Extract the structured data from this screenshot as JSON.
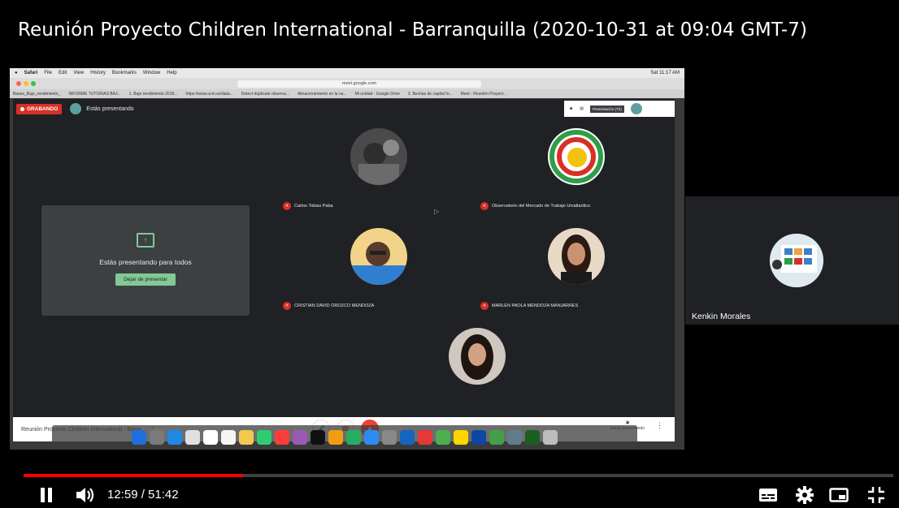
{
  "video": {
    "title": "Reunión Proyecto Children International - Barranquilla (2020-10-31 at 09:04 GMT-7)"
  },
  "mac": {
    "menubar": [
      "Safari",
      "File",
      "Edit",
      "View",
      "History",
      "Bookmarks",
      "Window",
      "Help"
    ],
    "clock": "Sat 11:17 AM",
    "url": "meet.google.com",
    "bookmarks": [
      "Bases_Bajo_rendimiento_",
      "INFORME TUTORIAS BAJ...",
      "1. Bajo rendimiento 2018...",
      "https://www.ucm.es/data...",
      "Detect duplicate observa...",
      "Almacenamiento en la nu...",
      "Mi unidad - Google Drive",
      "3. Bechas de capital fo...",
      "Meet - Reunión Proyect..."
    ]
  },
  "meet": {
    "recording_label": "GRABANDO",
    "presenting_label": "Estás presentando",
    "presentation_chip": "Presentación (Tú)",
    "present_card": {
      "text": "Estás presentando para todos",
      "button": "Dejar de presentar"
    },
    "participants": [
      {
        "name": "Carlos Tobias Paba"
      },
      {
        "name": "Observatorio del Mercado de Trabajo Uniatlantico"
      },
      {
        "name": "CRISTIAN DAVID OROZCO MENDOZA"
      },
      {
        "name": "MARLEN PAOLA MENDOZA MANJARRES"
      }
    ],
    "meeting_name": "Reunión Proyecto Children International - Barra...",
    "present_now_label": "Estás presentando"
  },
  "side_panel": {
    "name": "Kenkin Morales"
  },
  "player": {
    "current_time": "12:59",
    "duration": "51:42",
    "time_display": "12:59 / 51:42",
    "progress": 0.2525,
    "colors": {
      "progress": "#ff0000"
    },
    "icons": [
      "pause-icon",
      "volume-icon",
      "subtitles-icon",
      "settings-icon",
      "miniplayer-icon",
      "exit-fullscreen-icon"
    ]
  }
}
